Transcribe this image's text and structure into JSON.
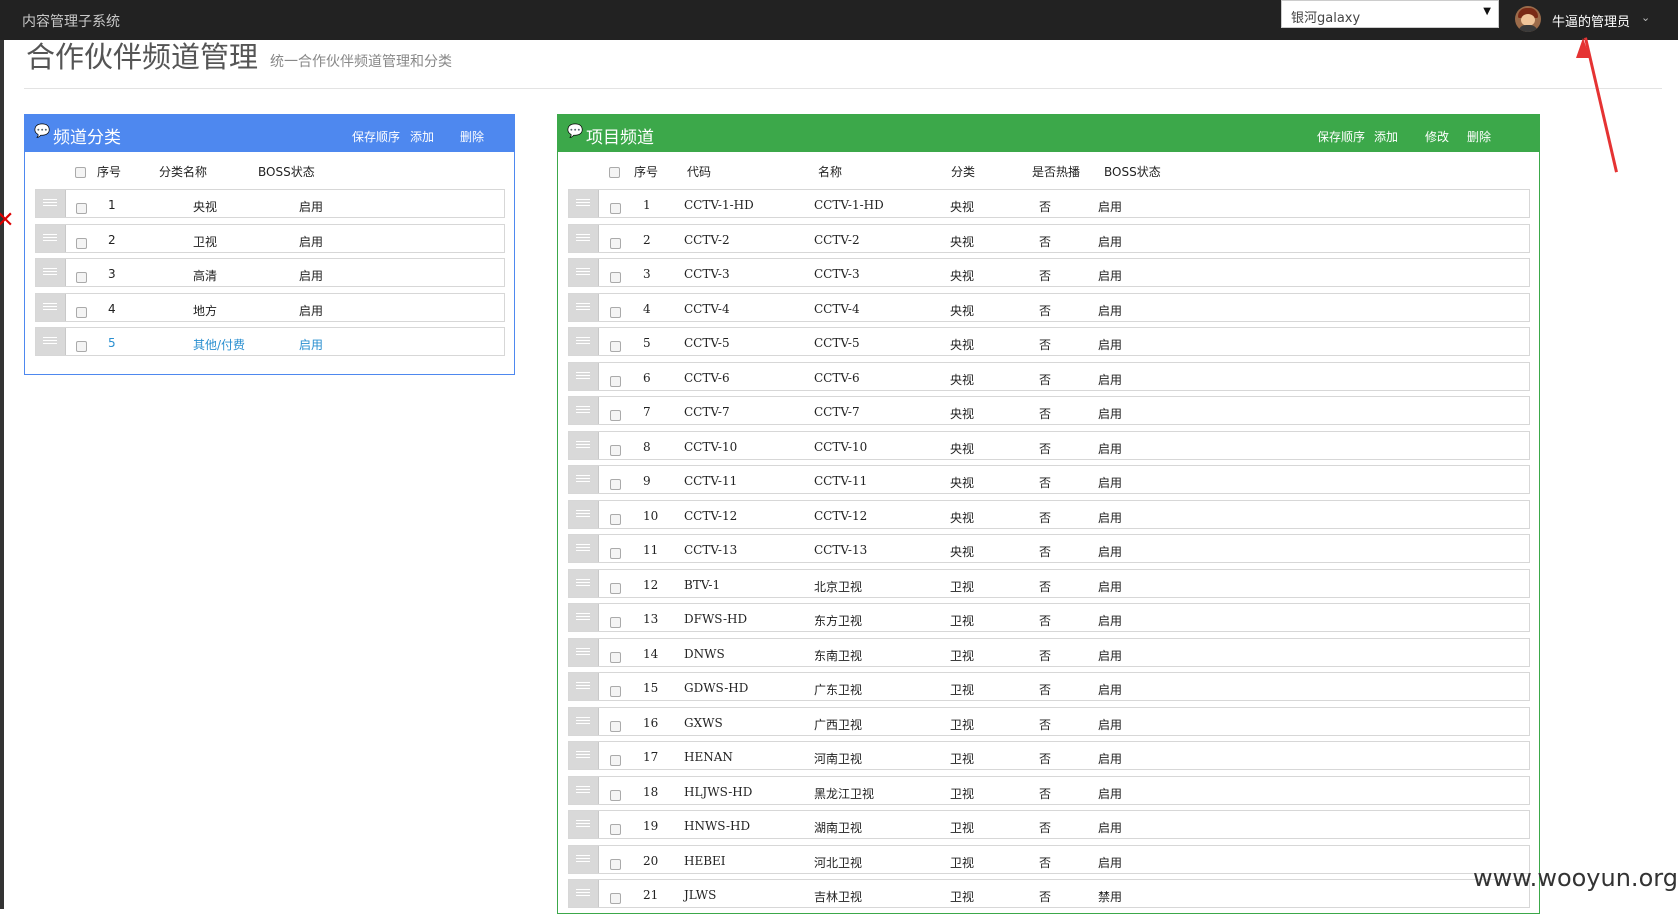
{
  "app": {
    "brand": "内容管理子系统"
  },
  "topbar": {
    "org_select": {
      "value": "银河galaxy"
    },
    "user": {
      "name": "牛逼的管理员"
    }
  },
  "page": {
    "title": "合作伙伴频道管理",
    "subtitle": "统一合作伙伴频道管理和分类"
  },
  "category_panel": {
    "title": "频道分类",
    "actions": [
      "保存顺序",
      "添加",
      "删除"
    ],
    "columns": [
      "序号",
      "分类名称",
      "BOSS状态"
    ],
    "rows": [
      [
        "1",
        "央视",
        "启用"
      ],
      [
        "2",
        "卫视",
        "启用"
      ],
      [
        "3",
        "高清",
        "启用"
      ],
      [
        "4",
        "地方",
        "启用"
      ],
      [
        "5",
        "其他/付费",
        "启用"
      ]
    ],
    "active_row": 4
  },
  "channel_panel": {
    "title": "项目频道",
    "actions": [
      "保存顺序",
      "添加",
      "修改",
      "删除"
    ],
    "columns": [
      "序号",
      "代码",
      "名称",
      "分类",
      "是否热播",
      "BOSS状态"
    ],
    "rows": [
      [
        "1",
        "CCTV-1-HD",
        "CCTV-1-HD",
        "央视",
        "否",
        "启用"
      ],
      [
        "2",
        "CCTV-2",
        "CCTV-2",
        "央视",
        "否",
        "启用"
      ],
      [
        "3",
        "CCTV-3",
        "CCTV-3",
        "央视",
        "否",
        "启用"
      ],
      [
        "4",
        "CCTV-4",
        "CCTV-4",
        "央视",
        "否",
        "启用"
      ],
      [
        "5",
        "CCTV-5",
        "CCTV-5",
        "央视",
        "否",
        "启用"
      ],
      [
        "6",
        "CCTV-6",
        "CCTV-6",
        "央视",
        "否",
        "启用"
      ],
      [
        "7",
        "CCTV-7",
        "CCTV-7",
        "央视",
        "否",
        "启用"
      ],
      [
        "8",
        "CCTV-10",
        "CCTV-10",
        "央视",
        "否",
        "启用"
      ],
      [
        "9",
        "CCTV-11",
        "CCTV-11",
        "央视",
        "否",
        "启用"
      ],
      [
        "10",
        "CCTV-12",
        "CCTV-12",
        "央视",
        "否",
        "启用"
      ],
      [
        "11",
        "CCTV-13",
        "CCTV-13",
        "央视",
        "否",
        "启用"
      ],
      [
        "12",
        "BTV-1",
        "北京卫视",
        "卫视",
        "否",
        "启用"
      ],
      [
        "13",
        "DFWS-HD",
        "东方卫视",
        "卫视",
        "否",
        "启用"
      ],
      [
        "14",
        "DNWS",
        "东南卫视",
        "卫视",
        "否",
        "启用"
      ],
      [
        "15",
        "GDWS-HD",
        "广东卫视",
        "卫视",
        "否",
        "启用"
      ],
      [
        "16",
        "GXWS",
        "广西卫视",
        "卫视",
        "否",
        "启用"
      ],
      [
        "17",
        "HENAN",
        "河南卫视",
        "卫视",
        "否",
        "启用"
      ],
      [
        "18",
        "HLJWS-HD",
        "黑龙江卫视",
        "卫视",
        "否",
        "启用"
      ],
      [
        "19",
        "HNWS-HD",
        "湖南卫视",
        "卫视",
        "否",
        "启用"
      ],
      [
        "20",
        "HEBEI",
        "河北卫视",
        "卫视",
        "否",
        "启用"
      ],
      [
        "21",
        "JLWS",
        "吉林卫视",
        "卫视",
        "否",
        "禁用"
      ]
    ]
  },
  "watermark": "www.wooyun.org",
  "colors": {
    "topbar": "#222222",
    "category_header": "#4e88ef",
    "channel_header": "#3ca84a",
    "active_row_text": "#2a8fd0",
    "annotation_arrow": "#e53333"
  }
}
